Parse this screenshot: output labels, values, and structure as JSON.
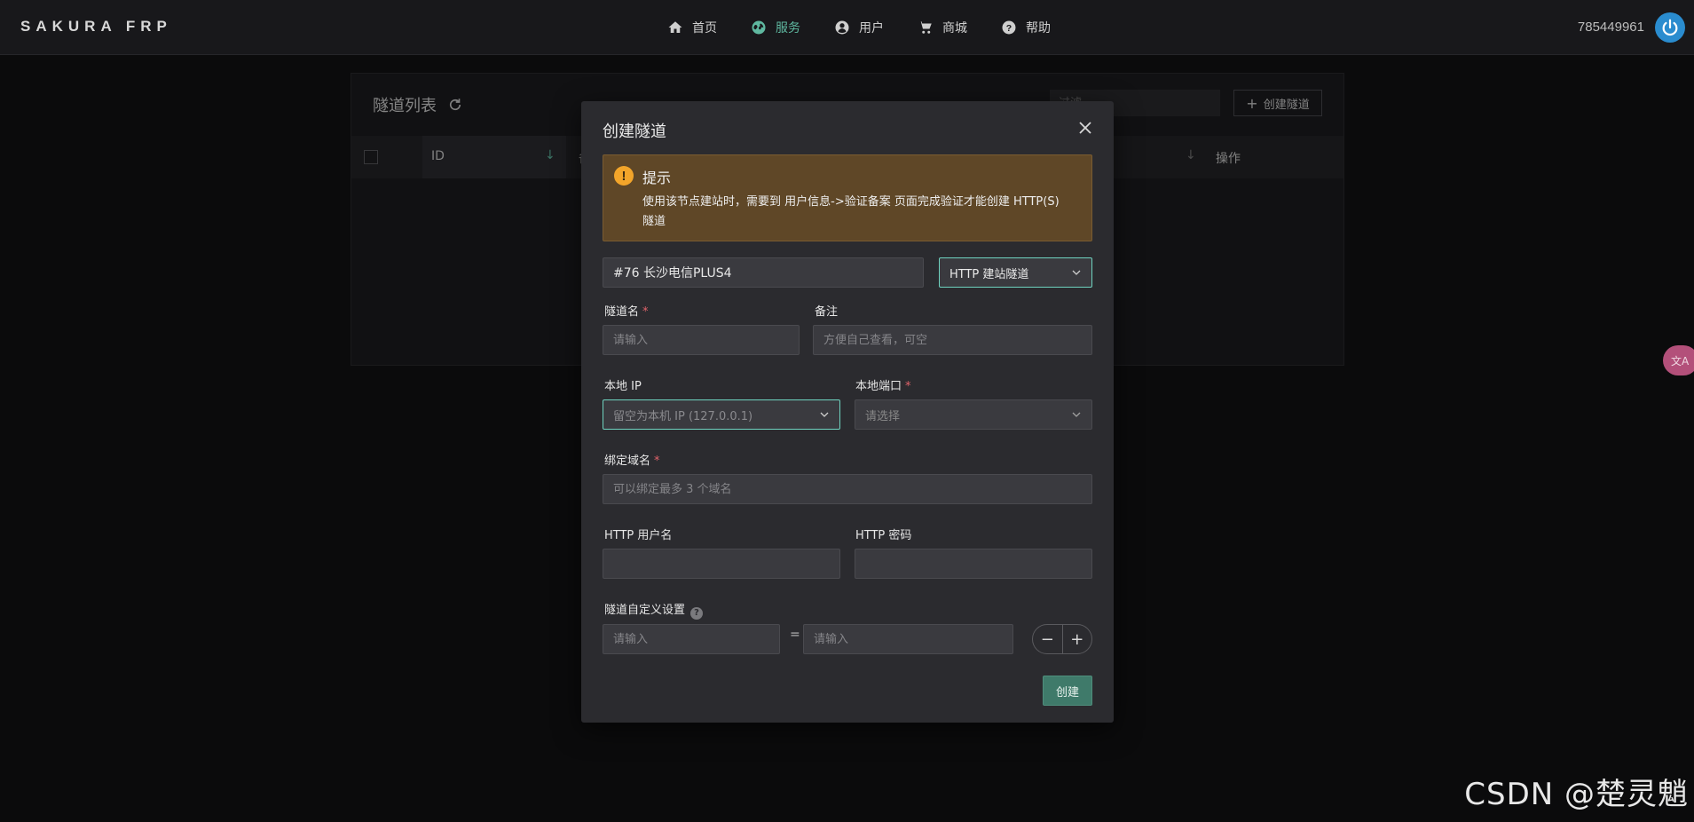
{
  "brand": "SAKURA FRP",
  "nav": [
    {
      "label": "首页",
      "icon": "home-icon"
    },
    {
      "label": "服务",
      "icon": "globe-icon",
      "active": true
    },
    {
      "label": "用户",
      "icon": "user-icon"
    },
    {
      "label": "商城",
      "icon": "cart-icon"
    },
    {
      "label": "帮助",
      "icon": "help-icon"
    }
  ],
  "user_id": "785449961",
  "background_page": {
    "title": "隧道列表",
    "filter_placeholder": "过滤",
    "create_button": "创建隧道",
    "columns": {
      "id": "ID",
      "col2": "备",
      "ops": "操作"
    }
  },
  "modal": {
    "title": "创建隧道",
    "alert": {
      "title": "提示",
      "body": "使用该节点建站时，需要到 用户信息->验证备案 页面完成验证才能创建 HTTP(S) 隧道"
    },
    "node_value": "#76 长沙电信PLUS4",
    "tunnel_type": "HTTP 建站隧道",
    "fields": {
      "tunnel_name_label": "隧道名",
      "tunnel_name_placeholder": "请输入",
      "note_label": "备注",
      "note_placeholder": "方便自己查看，可空",
      "local_ip_label": "本地 IP",
      "local_ip_placeholder": "留空为本机 IP (127.0.0.1)",
      "local_port_label": "本地端口",
      "local_port_placeholder": "请选择",
      "domain_label": "绑定域名",
      "domain_placeholder": "可以绑定最多 3 个域名",
      "http_user_label": "HTTP 用户名",
      "http_pass_label": "HTTP 密码",
      "custom_label": "隧道自定义设置",
      "custom_key_placeholder": "请输入",
      "custom_value_placeholder": "请输入",
      "equals": "="
    },
    "stepper": {
      "minus": "−",
      "plus": "+"
    },
    "submit": "创建"
  },
  "translate_tab": "文A",
  "watermark": "CSDN @楚灵魈",
  "colors": {
    "accent": "#5fb8a0",
    "warning_bg": "#5f4727",
    "required": "#e0636a",
    "power": "#2a8ccf"
  }
}
